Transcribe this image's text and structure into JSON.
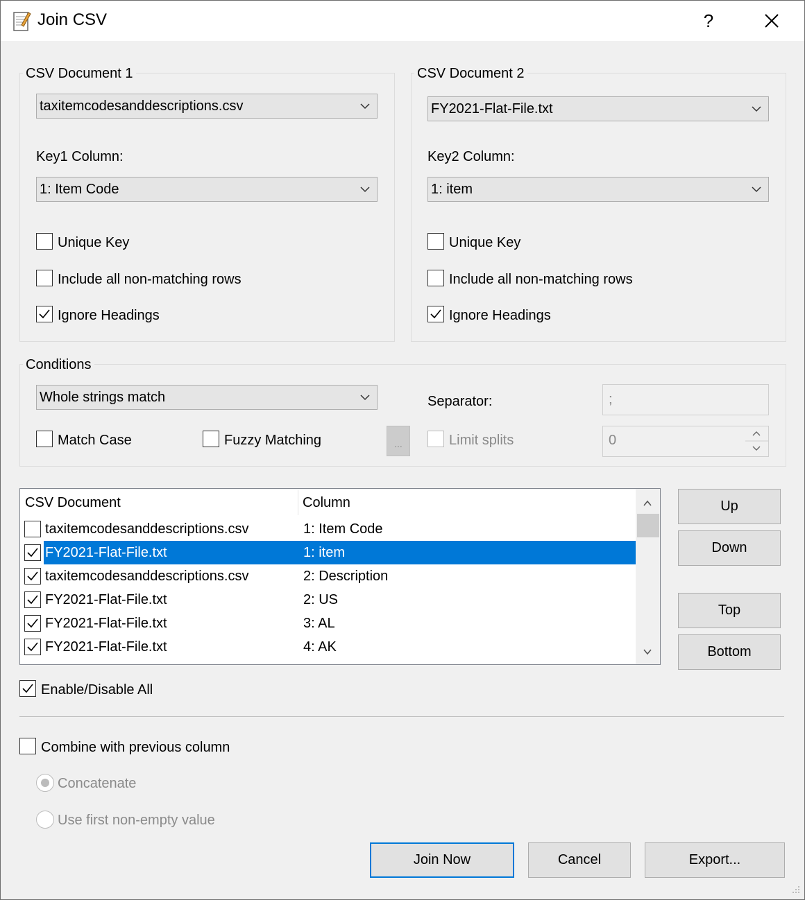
{
  "window": {
    "title": "Join CSV",
    "help_symbol": "?"
  },
  "doc1": {
    "legend": "CSV Document 1",
    "file": "taxitemcodesanddescriptions.csv",
    "key_label": "Key1 Column:",
    "key_value": "1: Item Code",
    "unique_key": "Unique Key",
    "include_nonmatching": "Include all non-matching rows",
    "ignore_headings": "Ignore Headings"
  },
  "doc2": {
    "legend": "CSV Document 2",
    "file": "FY2021-Flat-File.txt",
    "key_label": "Key2 Column:",
    "key_value": "1: item",
    "unique_key": "Unique Key",
    "include_nonmatching": "Include all non-matching rows",
    "ignore_headings": "Ignore Headings"
  },
  "conditions": {
    "legend": "Conditions",
    "mode": "Whole strings match",
    "match_case": "Match Case",
    "fuzzy": "Fuzzy Matching",
    "ellipsis": "...",
    "separator_label": "Separator:",
    "separator_value": ";",
    "limit_splits": "Limit splits",
    "limit_value": "0"
  },
  "columns": {
    "headers": [
      "CSV Document",
      "Column"
    ],
    "rows": [
      {
        "doc": "taxitemcodesanddescriptions.csv",
        "col": "1: Item Code",
        "checked": false,
        "selected": false
      },
      {
        "doc": "FY2021-Flat-File.txt",
        "col": "1: item",
        "checked": true,
        "selected": true
      },
      {
        "doc": "taxitemcodesanddescriptions.csv",
        "col": "2: Description",
        "checked": true,
        "selected": false
      },
      {
        "doc": "FY2021-Flat-File.txt",
        "col": "2: US",
        "checked": true,
        "selected": false
      },
      {
        "doc": "FY2021-Flat-File.txt",
        "col": "3: AL",
        "checked": true,
        "selected": false
      },
      {
        "doc": "FY2021-Flat-File.txt",
        "col": "4: AK",
        "checked": true,
        "selected": false
      }
    ]
  },
  "order_buttons": {
    "up": "Up",
    "down": "Down",
    "top": "Top",
    "bottom": "Bottom"
  },
  "enable_all": "Enable/Disable All",
  "combine": {
    "label": "Combine with previous column",
    "concatenate": "Concatenate",
    "first_nonempty": "Use first non-empty value"
  },
  "footer": {
    "join": "Join Now",
    "cancel": "Cancel",
    "export": "Export..."
  },
  "colors": {
    "selection": "#0078d7",
    "dialog_bg": "#f0f0f0"
  }
}
